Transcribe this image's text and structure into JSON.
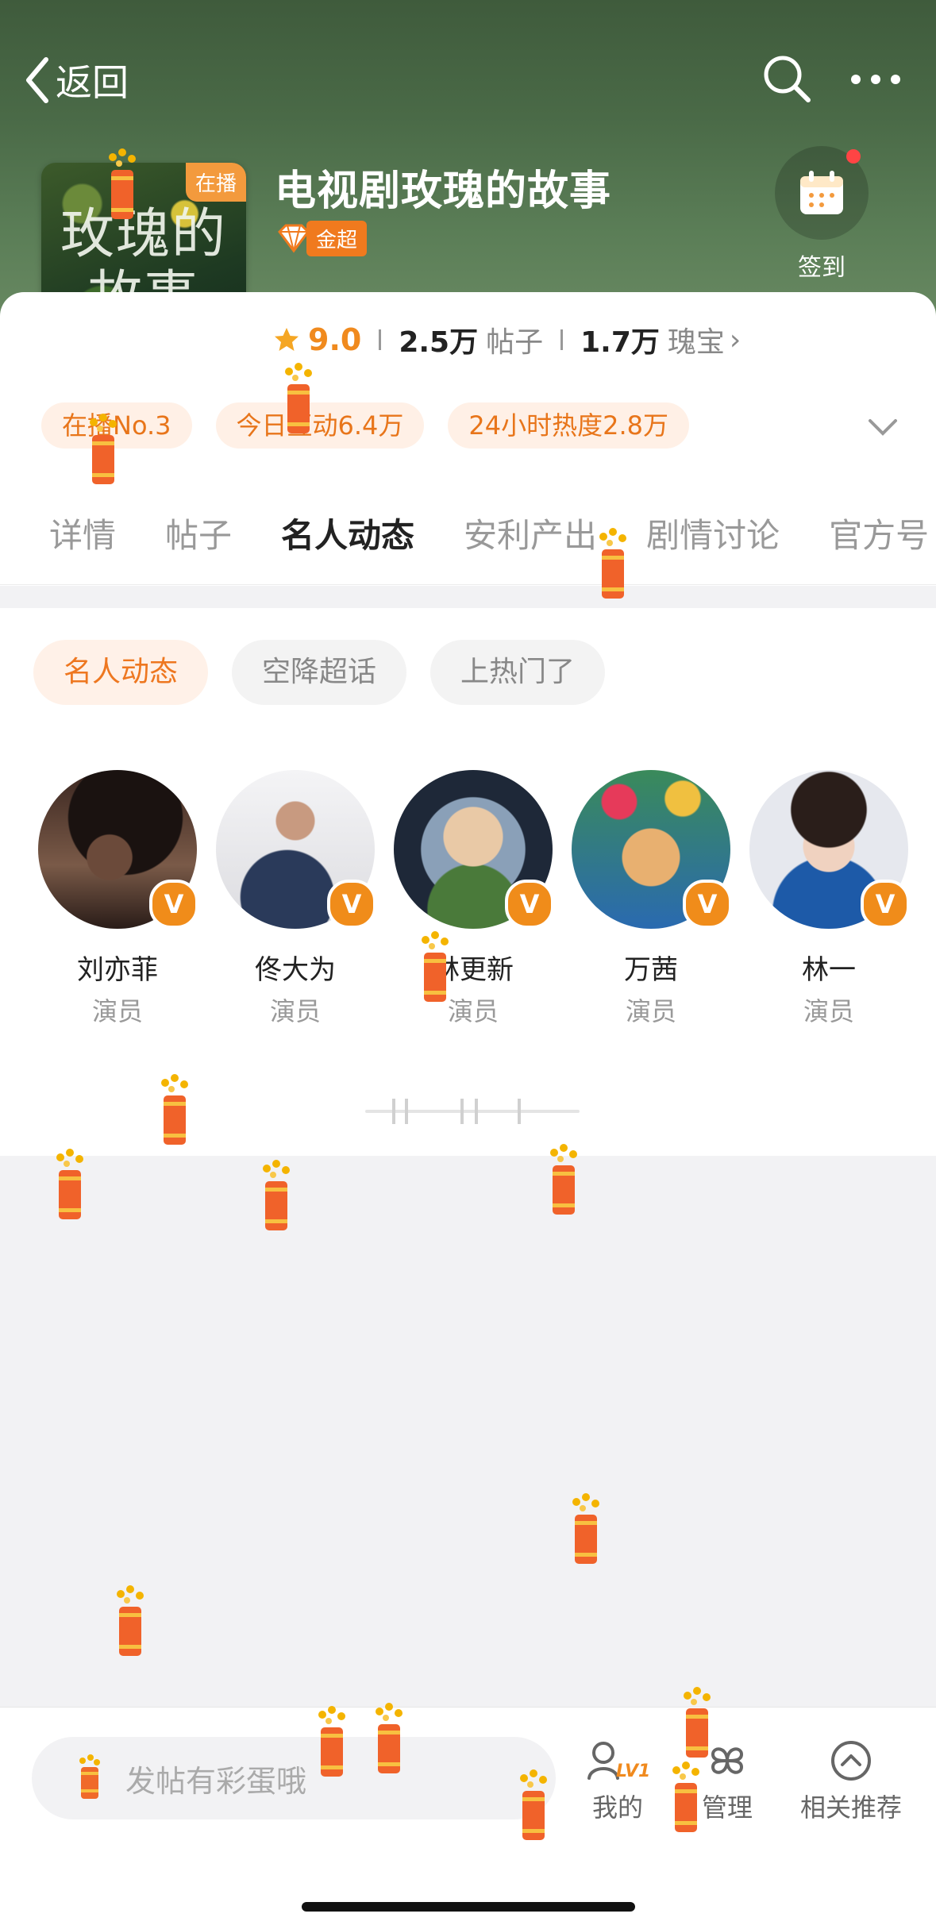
{
  "header": {
    "back_label": "返回",
    "topic_title": "电视剧玫瑰的故事",
    "cover_text": "玫瑰的故事",
    "live_tag": "在播",
    "badge_label": "金超",
    "checkin_label": "签到"
  },
  "stats": {
    "score": "9.0",
    "posts_value": "2.5万",
    "posts_unit": "帖子",
    "treasure_value": "1.7万",
    "treasure_unit": "瑰宝"
  },
  "chips": [
    "在播No.3",
    "今日互动6.4万",
    "24小时热度2.8万"
  ],
  "tabs": [
    "详情",
    "帖子",
    "名人动态",
    "安利产出",
    "剧情讨论",
    "官方号"
  ],
  "active_tab": "名人动态",
  "subtabs": [
    "名人动态",
    "空降超话",
    "上热门了"
  ],
  "celebrities": [
    {
      "name": "刘亦菲",
      "role": "演员"
    },
    {
      "name": "佟大为",
      "role": "演员"
    },
    {
      "name": "林更新",
      "role": "演员"
    },
    {
      "name": "万茜",
      "role": "演员"
    },
    {
      "name": "林一",
      "role": "演员"
    }
  ],
  "bottom_bar": {
    "input_placeholder": "发帖有彩蛋哦",
    "mine_label": "我的",
    "level_tag": "LV1",
    "manage_label": "管理",
    "recommend_label": "相关推荐"
  },
  "colors": {
    "accent": "#f37a2a",
    "verified": "#f08c1a",
    "chip_bg": "#fff0e6"
  },
  "icons": [
    "chevron-left-icon",
    "search-icon",
    "more-icon",
    "calendar-icon",
    "star-icon",
    "chevron-down-icon",
    "firecracker-icon",
    "person-icon",
    "grid-icon",
    "circle-chevron-up-icon"
  ]
}
